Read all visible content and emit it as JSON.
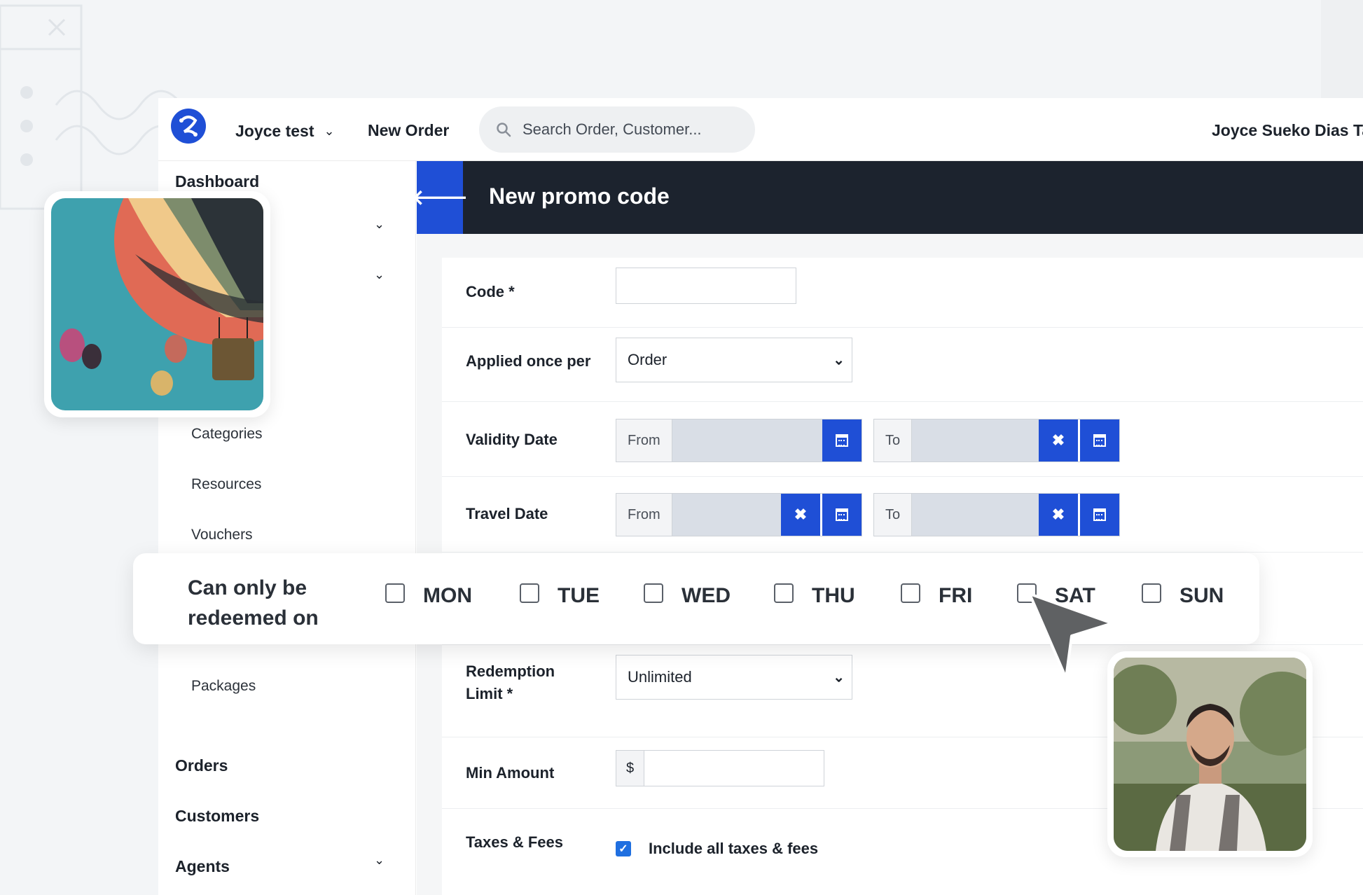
{
  "topbar": {
    "account_name": "Joyce test",
    "new_order_label": "New Order",
    "search_placeholder": "Search Order, Customer...",
    "user_name": "Joyce Sueko Dias Ta"
  },
  "sidebar": {
    "dashboard": "Dashboard",
    "sub_items": [
      "Categories",
      "Resources",
      "Vouchers",
      "Packages"
    ],
    "orders": "Orders",
    "customers": "Customers",
    "agents": "Agents"
  },
  "page": {
    "title": "New promo code"
  },
  "form": {
    "code_label": "Code *",
    "applied_once_label": "Applied once per",
    "applied_once_value": "Order",
    "validity_label": "Validity Date",
    "travel_label": "Travel Date",
    "from_label": "From",
    "to_label": "To",
    "redemption_label_line1": "Redemption",
    "redemption_label_line2": "Limit *",
    "redemption_value": "Unlimited",
    "min_amount_label": "Min Amount",
    "currency_symbol": "$",
    "taxes_label": "Taxes & Fees",
    "taxes_checkbox_label": "Include all taxes & fees",
    "taxes_checked": true
  },
  "days_panel": {
    "label_line1": "Can only be",
    "label_line2": "redeemed on",
    "days": [
      "MON",
      "TUE",
      "WED",
      "THU",
      "FRI",
      "SAT",
      "SUN"
    ]
  },
  "colors": {
    "accent_blue": "#1f4fd6",
    "title_bar": "#1c232e",
    "date_field": "#d9dee6"
  },
  "icons": {
    "logo": "brand-logo-icon",
    "search": "search-icon",
    "back": "arrow-left-icon",
    "calendar": "calendar-icon",
    "clear": "close-icon",
    "chevron": "chevron-down-icon",
    "cursor": "mouse-pointer-icon"
  }
}
